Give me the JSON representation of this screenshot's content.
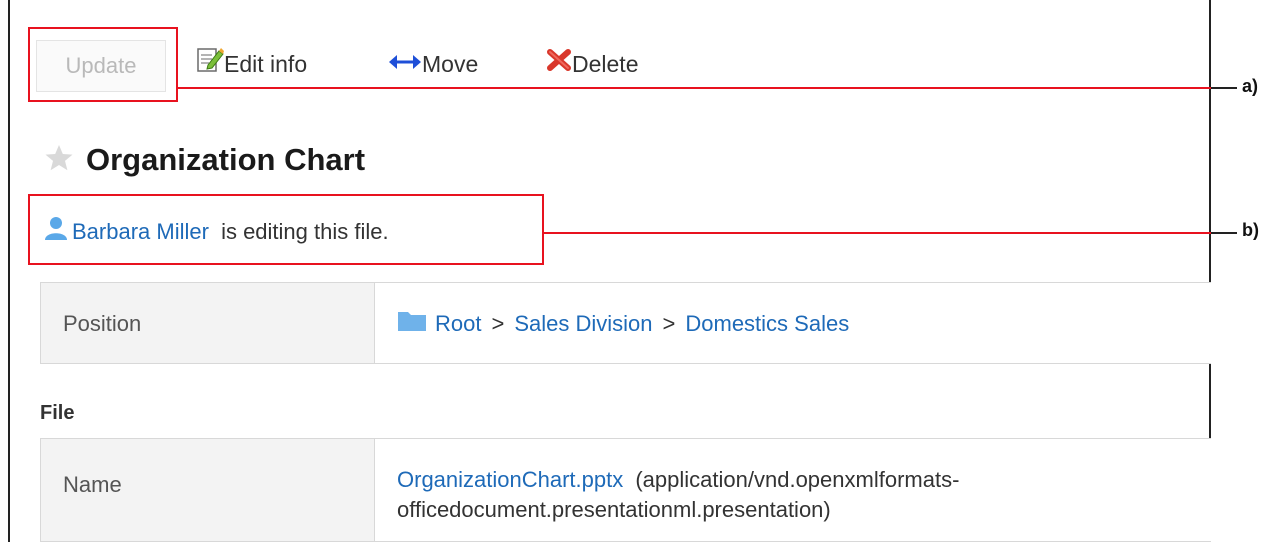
{
  "toolbar": {
    "update_label": "Update",
    "edit_info_label": "Edit info",
    "move_label": "Move",
    "delete_label": "Delete"
  },
  "file": {
    "title": "Organization Chart",
    "editing_user": "Barbara Miller",
    "editing_suffix": "is editing this file."
  },
  "details": {
    "position_label": "Position",
    "breadcrumb": [
      "Root",
      "Sales Division",
      "Domestics Sales"
    ],
    "breadcrumb_separator": ">",
    "file_section_label": "File",
    "name_label": "Name",
    "file_name": "OrganizationChart.pptx",
    "mime_line1": "(application/vnd.openxmlformats-",
    "mime_line2": "officedocument.presentationml.presentation)"
  },
  "annotations": {
    "a": "a)",
    "b": "b)"
  },
  "colors": {
    "link": "#1e6ab8",
    "annotation": "#e8121f"
  },
  "icons": {
    "edit": "edit-pencil-icon",
    "move": "double-arrow-icon",
    "delete": "red-x-icon",
    "star": "star-icon",
    "user": "user-icon",
    "folder": "folder-icon"
  }
}
